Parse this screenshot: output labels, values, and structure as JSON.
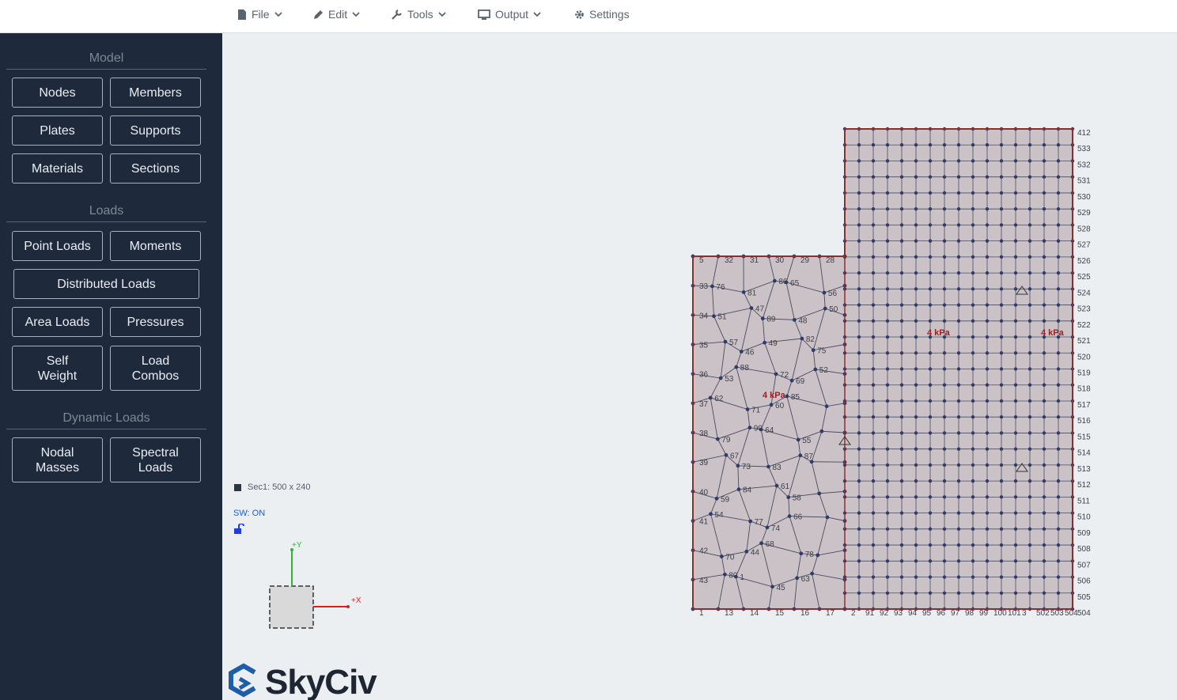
{
  "menu": {
    "file": "File",
    "edit": "Edit",
    "tools": "Tools",
    "output": "Output",
    "settings": "Settings"
  },
  "sidebar": {
    "model_title": "Model",
    "loads_title": "Loads",
    "dynamic_title": "Dynamic Loads",
    "buttons": {
      "nodes": "Nodes",
      "members": "Members",
      "plates": "Plates",
      "supports": "Supports",
      "materials": "Materials",
      "sections": "Sections",
      "point_loads": "Point Loads",
      "moments": "Moments",
      "distributed_loads": "Distributed Loads",
      "area_loads": "Area Loads",
      "pressures": "Pressures",
      "self_weight_1": "Self",
      "self_weight_2": "Weight",
      "load_combos_1": "Load",
      "load_combos_2": "Combos",
      "nodal_masses_1": "Nodal",
      "nodal_masses_2": "Masses",
      "spectral_loads_1": "Spectral",
      "spectral_loads_2": "Loads"
    }
  },
  "canvas": {
    "section_info": "Sec1: 500 x 240",
    "sw_status": "SW: ON",
    "axis_y": "+Y",
    "axis_x": "+X",
    "pressure_label_1": "4 kPa",
    "pressure_label_2": "4 kPa",
    "pressure_label_3": "4 kPa",
    "logo": "SkyCiv"
  },
  "mesh": {
    "left_top_labels": [
      "5",
      "32",
      "31",
      "30",
      "29",
      "28"
    ],
    "left_side_labels": [
      "33",
      "34",
      "35",
      "36",
      "37",
      "38",
      "39",
      "40",
      "41",
      "42",
      "43"
    ],
    "bottom_labels": [
      "1",
      "13",
      "14",
      "15",
      "16",
      "17",
      "2",
      "91",
      "92",
      "93",
      "94",
      "95",
      "96",
      "97",
      "98",
      "99",
      "100",
      "101",
      "3",
      "502",
      "503",
      "504"
    ],
    "right_labels": [
      "412",
      "533",
      "532",
      "531",
      "530",
      "529",
      "528",
      "527",
      "526",
      "525",
      "524",
      "523",
      "522",
      "521",
      "520",
      "519",
      "518",
      "517",
      "516",
      "515",
      "514",
      "513",
      "512",
      "511",
      "510",
      "509",
      "508",
      "507",
      "506",
      "505",
      "504"
    ],
    "interior_labels": [
      "76",
      "51",
      "57",
      "53",
      "62",
      "79",
      "67",
      "59",
      "54",
      "70",
      "80",
      "81",
      "47",
      "46",
      "88",
      "71",
      "90",
      "73",
      "84",
      "77",
      "44",
      "1",
      "86",
      "89",
      "49",
      "72",
      "60",
      "64",
      "83",
      "61",
      "74",
      "68",
      "45",
      "65",
      "48",
      "82",
      "69",
      "85",
      "55",
      "87",
      "58",
      "66",
      "78",
      "63",
      "56",
      "50",
      "75",
      "52"
    ],
    "colors": {
      "plate_fill": "#cbc2c8",
      "plate_edge": "#8e2d2d",
      "node": "#2f3b6b",
      "mesh_line": "#4b4b5c",
      "axis_y": "#2fb52f",
      "axis_x": "#d42020",
      "logo_blue": "#1e5ea8"
    }
  }
}
